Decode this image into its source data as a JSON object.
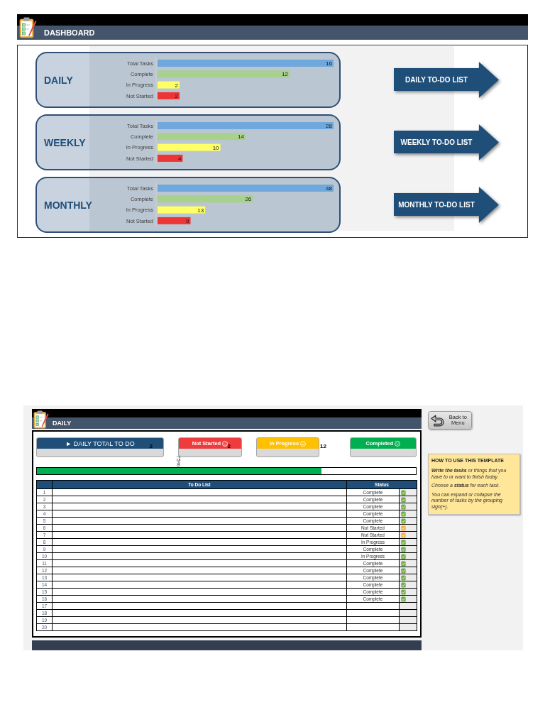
{
  "dashboard": {
    "title": "DASHBOARD",
    "cards": [
      {
        "title": "DAILY",
        "chart_data": {
          "type": "bar",
          "orientation": "horizontal",
          "categories": [
            "Total Tasks",
            "Complete",
            "In Progress",
            "Not Started"
          ],
          "series": [
            {
              "color": "#6fa8dc",
              "values": [
                16,
                null,
                null,
                null
              ]
            },
            {
              "color": "#a9d18e",
              "values": [
                null,
                12,
                null,
                null
              ]
            },
            {
              "color": "#ffff66",
              "values": [
                null,
                null,
                2,
                null
              ]
            },
            {
              "color": "#ee3535",
              "values": [
                null,
                null,
                null,
                2
              ]
            }
          ],
          "stacked": true,
          "data_labels": true
        },
        "link": "DAILY TO-DO LIST"
      },
      {
        "title": "WEEKLY",
        "chart_data": {
          "type": "bar",
          "orientation": "horizontal",
          "categories": [
            "Total Tasks",
            "Complete",
            "In Progress",
            "Not Started"
          ],
          "series": [
            {
              "color": "#6fa8dc",
              "values": [
                28,
                null,
                null,
                null
              ]
            },
            {
              "color": "#a9d18e",
              "values": [
                null,
                14,
                null,
                null
              ]
            },
            {
              "color": "#ffff66",
              "values": [
                null,
                null,
                10,
                null
              ]
            },
            {
              "color": "#ee3535",
              "values": [
                null,
                null,
                null,
                4
              ]
            }
          ],
          "stacked": true,
          "data_labels": true
        },
        "link": "WEEKLY TO-DO LIST"
      },
      {
        "title": "MONTHLY",
        "chart_data": {
          "type": "bar",
          "orientation": "horizontal",
          "categories": [
            "Total Tasks",
            "Complete",
            "In Progress",
            "Not Started"
          ],
          "series": [
            {
              "color": "#6fa8dc",
              "values": [
                48,
                null,
                null,
                null
              ]
            },
            {
              "color": "#a9d18e",
              "values": [
                null,
                26,
                null,
                null
              ]
            },
            {
              "color": "#ffff66",
              "values": [
                null,
                null,
                13,
                null
              ]
            },
            {
              "color": "#ee3535",
              "values": [
                null,
                null,
                null,
                9
              ]
            }
          ],
          "stacked": true,
          "data_labels": true
        },
        "link": "MONTHLY TO-DO LIST"
      }
    ]
  },
  "daily_sheet": {
    "title": "DAILY",
    "summary": [
      {
        "kind": "total",
        "label": "► DAILY TOTAL TO DO",
        "value": "2"
      },
      {
        "kind": "not_started",
        "label": "Not Started",
        "value": "2"
      },
      {
        "kind": "in_progress",
        "label": "In Progress",
        "value": "12"
      },
      {
        "kind": "completed",
        "label": "Completed"
      }
    ],
    "percent": "75%",
    "progress": {
      "level": 0.75
    },
    "table": {
      "columns": [
        "To Do List",
        "Status"
      ],
      "rows": [
        {
          "number": "1",
          "status": "Complete",
          "color": "#70ad47"
        },
        {
          "number": "2",
          "status": "Complete",
          "color": "#70ad47"
        },
        {
          "number": "3",
          "status": "Complete",
          "color": "#70ad47"
        },
        {
          "number": "4",
          "status": "Complete",
          "color": "#70ad47"
        },
        {
          "number": "5",
          "status": "Complete",
          "color": "#70ad47"
        },
        {
          "number": "6",
          "status": "Not Started",
          "color": "#f5b041"
        },
        {
          "number": "7",
          "status": "Not Started",
          "color": "#f5b041"
        },
        {
          "number": "8",
          "status": "In Progress",
          "color": "#70ad47"
        },
        {
          "number": "9",
          "status": "Complete",
          "color": "#70ad47"
        },
        {
          "number": "10",
          "status": "In Progress",
          "color": "#70ad47"
        },
        {
          "number": "11",
          "status": "Complete",
          "color": "#70ad47"
        },
        {
          "number": "12",
          "status": "Complete",
          "color": "#70ad47"
        },
        {
          "number": "13",
          "status": "Complete",
          "color": "#70ad47"
        },
        {
          "number": "14",
          "status": "Complete",
          "color": "#70ad47"
        },
        {
          "number": "15",
          "status": "Complete",
          "color": "#70ad47"
        },
        {
          "number": "16",
          "status": "Complete",
          "color": "#70ad47"
        },
        {
          "number": "17"
        },
        {
          "number": "18"
        },
        {
          "number": "19"
        },
        {
          "number": "20"
        }
      ]
    },
    "back_button": "Back to Menu",
    "note": {
      "title": "HOW TO USE THIS TEMPLATE",
      "paragraphs": [
        "**Write the tasks** or things that you have to or want to finish today.",
        "Choose a **status** for each task.",
        "You can expand or collapse the number of tasks by the grouping sign(+)."
      ]
    }
  }
}
